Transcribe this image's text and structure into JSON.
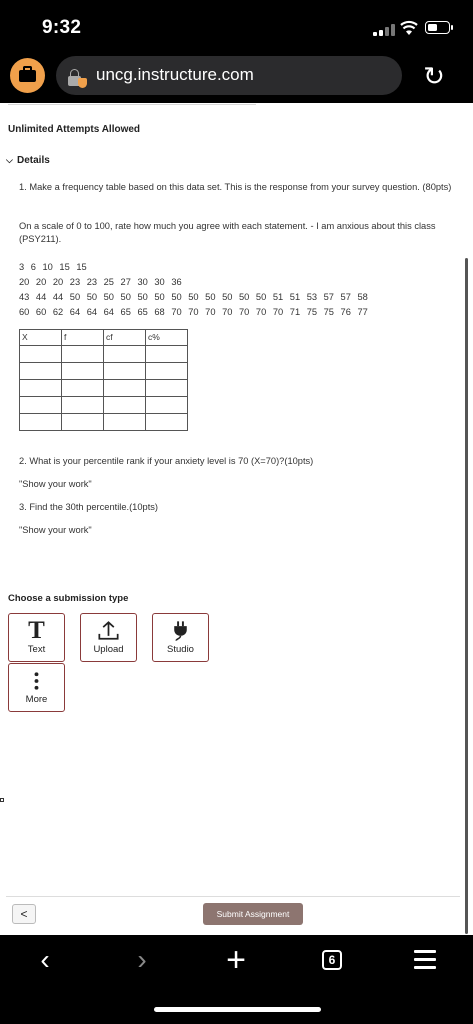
{
  "status_bar": {
    "time": "9:32"
  },
  "browser": {
    "url": "uncg.instructure.com",
    "tab_count": "6"
  },
  "assignment": {
    "attempts": "Unlimited Attempts Allowed",
    "details_label": "Details",
    "q1": "1. Make a frequency table based on this data set. This is the response from your survey question. (80pts)",
    "scale": "On a scale of 0 to 100, rate how much you agree with each statement. - I am anxious about this class (PSY211).",
    "rows": [
      "3 6 10 15 15",
      "20 20 20 23 23 25 27 30 30 36",
      "43 44 44 50 50 50 50 50 50 50 50 50 50 50 50 51 51 53 57 57 58",
      "60 60 62 64 64 64 65 65 68 70 70 70 70 70 70 70 71 75 75 76 77"
    ],
    "table_headers": [
      "X",
      "f",
      "cf",
      "c%"
    ],
    "q2": "2. What is your percentile rank if your anxiety level is 70 (X=70)?(10pts)",
    "show_work_1": "\"Show your work\"",
    "q3": "3. Find the 30th percentile.(10pts)",
    "show_work_2": "\"Show your work\""
  },
  "submission": {
    "title": "Choose a submission type",
    "text_label": "Text",
    "upload_label": "Upload",
    "studio_label": "Studio",
    "more_label": "More"
  },
  "footer": {
    "submit_label": "Submit Assignment"
  },
  "icons": {
    "tab": "briefcase-icon",
    "lock": "lock-icon",
    "reload": "reload-icon",
    "upload": "upload-arrow-icon",
    "studio": "plug-icon",
    "more": "vertical-dots-icon"
  },
  "colors": {
    "accent": "#f0a04b",
    "submit": "#8d7570",
    "button_border": "#8a3a3a"
  }
}
